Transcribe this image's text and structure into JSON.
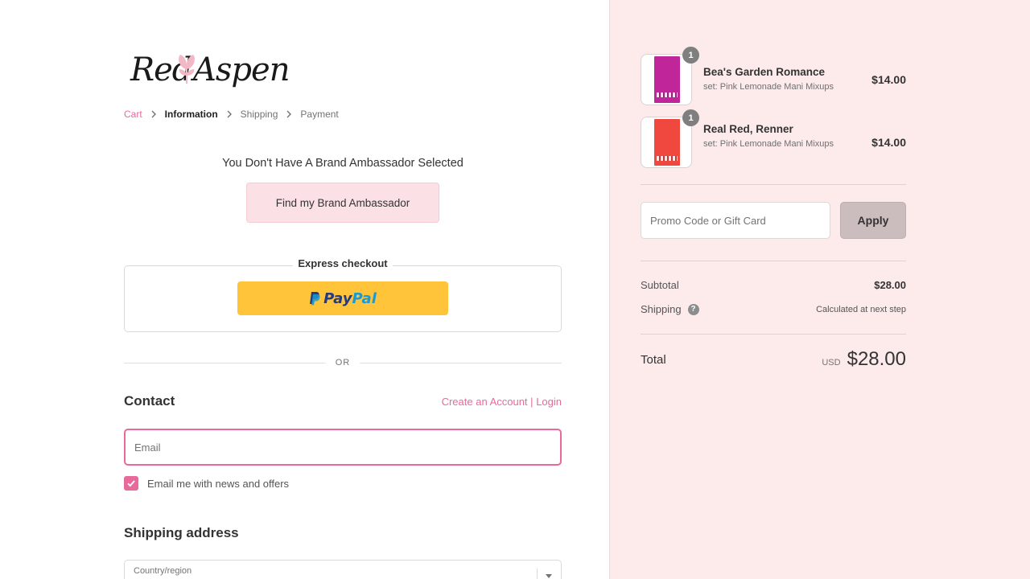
{
  "brand": {
    "logo_text_left": "Red",
    "logo_text_right": "Aspen",
    "accent_color": "#e76a9b"
  },
  "breadcrumb": {
    "items": [
      {
        "label": "Cart",
        "state": "link"
      },
      {
        "label": "Information",
        "state": "current"
      },
      {
        "label": "Shipping",
        "state": "upcoming"
      },
      {
        "label": "Payment",
        "state": "upcoming"
      }
    ],
    "separator_icon": "chevron-right-icon"
  },
  "ambassador": {
    "title": "You Don't Have A Brand Ambassador Selected",
    "button_label": "Find my Brand Ambassador"
  },
  "express_checkout": {
    "label": "Express checkout",
    "paypal_pay": "Pay",
    "paypal_pal": "Pal"
  },
  "divider_text": "OR",
  "contact": {
    "title": "Contact",
    "create_account": "Create an Account",
    "separator": "|",
    "login": "Login",
    "email_placeholder": "Email",
    "newsletter_label": "Email me with news and offers",
    "newsletter_checked": true
  },
  "shipping_address": {
    "title": "Shipping address",
    "country_label": "Country/region"
  },
  "cart": {
    "items": [
      {
        "name": "Bea's Garden Romance",
        "variant": "set: Pink Lemonade Mani Mixups",
        "price": "$14.00",
        "quantity": "1",
        "swatch_color": "#c0259a"
      },
      {
        "name": "Real Red, Renner",
        "variant": "set: Pink Lemonade Mani Mixups",
        "price": "$14.00",
        "quantity": "1",
        "swatch_color": "#f0483e"
      }
    ],
    "promo_placeholder": "Promo Code or Gift Card",
    "apply_label": "Apply",
    "subtotal_label": "Subtotal",
    "subtotal_value": "$28.00",
    "shipping_label": "Shipping",
    "shipping_value": "Calculated at next step",
    "total_label": "Total",
    "currency": "USD",
    "total_value": "$28.00"
  }
}
